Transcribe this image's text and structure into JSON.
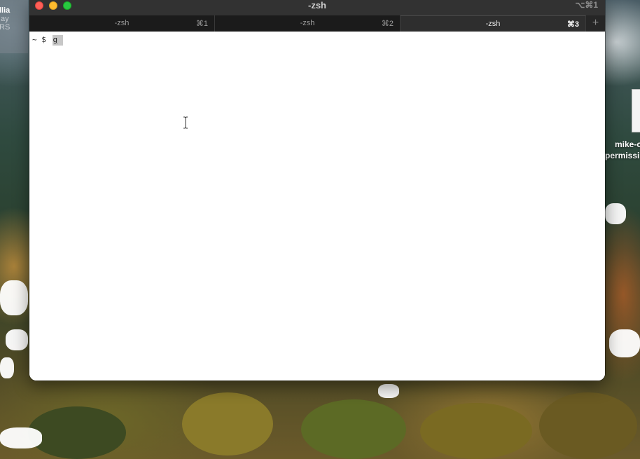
{
  "desktop": {
    "widget_lines": [
      "llia",
      "ay",
      "IRS"
    ],
    "file_label_lines": [
      "mike-c",
      "permissi"
    ]
  },
  "window": {
    "title": "-zsh",
    "shortcut": "⌥⌘1",
    "tabs": [
      {
        "label": "-zsh",
        "shortcut": "⌘1",
        "active": false
      },
      {
        "label": "-zsh",
        "shortcut": "⌘2",
        "active": false
      },
      {
        "label": "-zsh",
        "shortcut": "⌘3",
        "active": true
      }
    ],
    "new_tab_symbol": "+"
  },
  "terminal": {
    "prompt": "~ $ ",
    "input": "g"
  },
  "colors": {
    "close": "#ff5f57",
    "minimize": "#febc2e",
    "maximize": "#28c840",
    "titlebar": "#323232",
    "tabbar": "#1e1e1e",
    "terminal_background": "#ffffff",
    "cursor": "#c7c7c7"
  },
  "icons": [
    "close-button-icon",
    "minimize-button-icon",
    "maximize-button-icon",
    "plus-icon",
    "text-cursor-icon",
    "document-icon"
  ]
}
